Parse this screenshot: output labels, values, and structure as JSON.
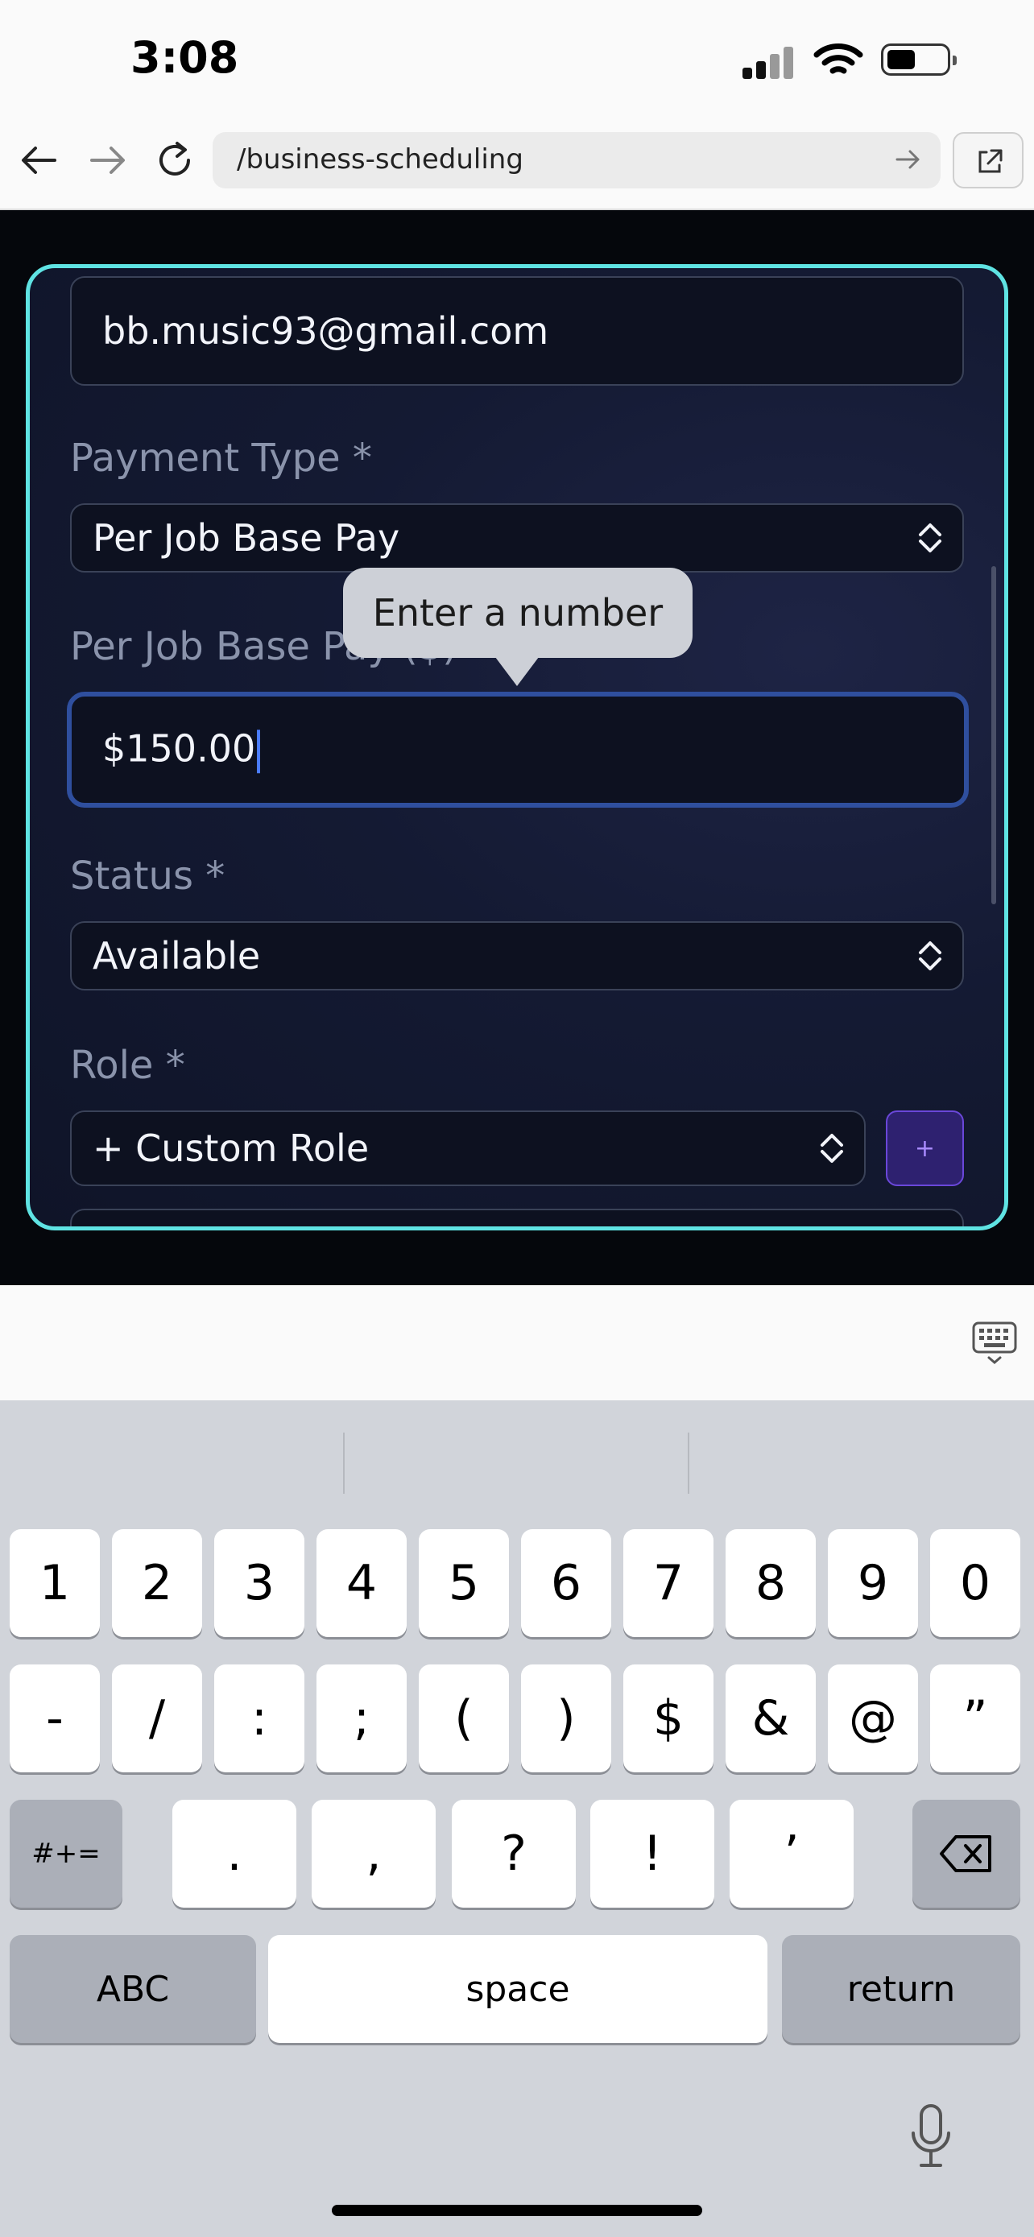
{
  "status_bar": {
    "time": "3:08"
  },
  "browser": {
    "url": "/business-scheduling"
  },
  "form": {
    "email_value": "bb.music93@gmail.com",
    "payment_type_label": "Payment Type *",
    "payment_type_value": "Per Job Base Pay",
    "base_pay_label": "Per Job Base Pay ($)",
    "base_pay_value": "$150.00",
    "status_label": "Status *",
    "status_value": "Available",
    "role_label": "Role *",
    "role_value": "+ Custom Role",
    "add_role_button": "+"
  },
  "tooltip": {
    "text": "Enter a number"
  },
  "keyboard": {
    "row1": [
      "1",
      "2",
      "3",
      "4",
      "5",
      "6",
      "7",
      "8",
      "9",
      "0"
    ],
    "row2": [
      "-",
      "/",
      ":",
      ";",
      "(",
      ")",
      "$",
      "&",
      "@",
      "”"
    ],
    "row3": [
      ".",
      ",",
      "?",
      "!",
      "’"
    ],
    "symbols_toggle": "#+=",
    "abc": "ABC",
    "space": "space",
    "return": "return"
  },
  "colors": {
    "accent_border": "#5fe3e3",
    "focus_ring": "#2f4f9e",
    "add_button": "#3b2a8a"
  },
  "icons": [
    "signal-icon",
    "wifi-icon",
    "battery-icon",
    "back-arrow-icon",
    "forward-arrow-icon",
    "reload-icon",
    "external-link-icon",
    "chevron-updown-icon",
    "keyboard-hide-icon",
    "backspace-icon",
    "microphone-icon"
  ]
}
